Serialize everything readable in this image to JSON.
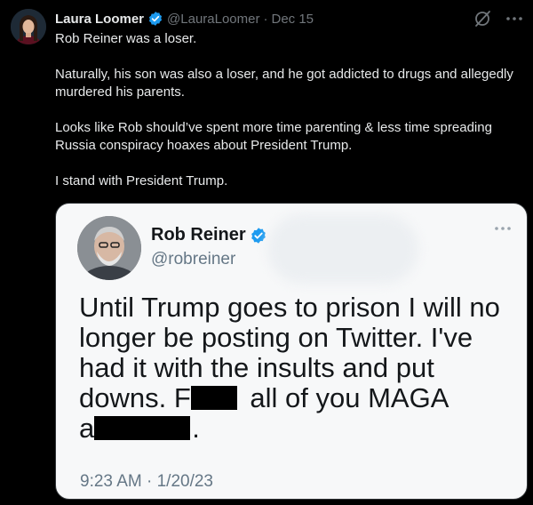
{
  "post": {
    "author": {
      "display_name": "Laura Loomer",
      "handle": "@LauraLoomer",
      "avatar_icon": "avatar-photo",
      "verified_icon": "verified-badge-icon"
    },
    "separator": "·",
    "date": "Dec 15",
    "top_icons": [
      "grok-icon",
      "more-icon"
    ],
    "text": {
      "p1": "Rob Reiner was a loser.",
      "p2": "Naturally, his son was also a loser, and he got addicted to drugs and allegedly murdered his parents.",
      "p3": "Looks like Rob should’ve spent more time parenting & less time spreading Russia conspiracy hoaxes about President Trump.",
      "p4": "I stand with President Trump."
    }
  },
  "embedded_screenshot": {
    "author": {
      "display_name": "Rob Reiner",
      "handle": "@robreiner",
      "verified_icon": "verified-badge-icon"
    },
    "body": {
      "part1": "Until Trump goes to prison I will no longer be posting on Twitter. I've had it with the insults and put downs. F",
      "part2": " all of you MAGA",
      "part3": "a",
      "part4": "."
    },
    "timestamp": "9:23 AM · 1/20/23"
  },
  "colors": {
    "background": "#000000",
    "text_primary": "#e7e9ea",
    "text_secondary": "#71767b",
    "verified_blue": "#1d9bf0",
    "embed_background": "#f7f8f9",
    "embed_text": "#14171a"
  }
}
